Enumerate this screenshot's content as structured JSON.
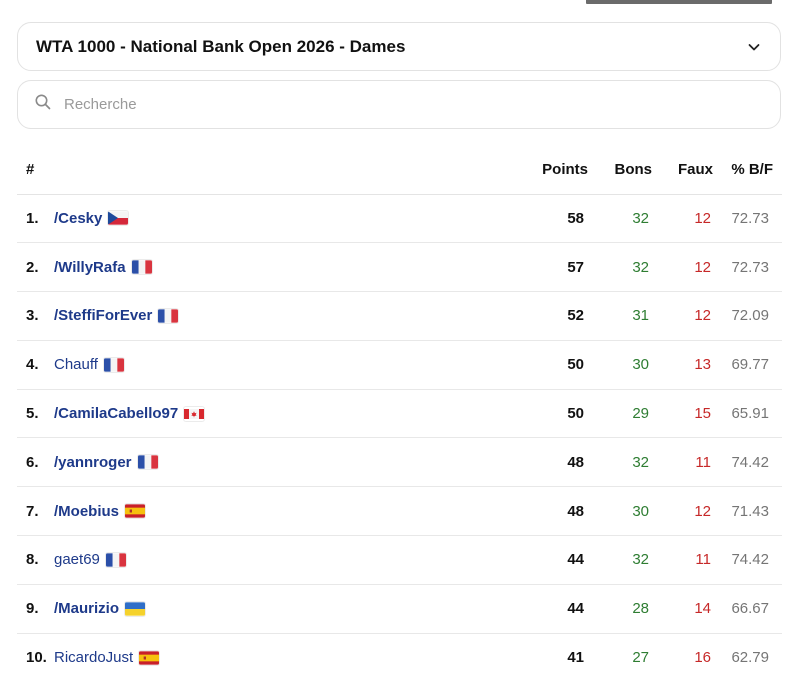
{
  "tournament_select": {
    "label": "WTA 1000 - National Bank Open 2026 - Dames"
  },
  "search": {
    "placeholder": "Recherche",
    "value": ""
  },
  "table": {
    "headers": {
      "rank": "#",
      "points": "Points",
      "bons": "Bons",
      "faux": "Faux",
      "pct": "% B/F"
    },
    "rows": [
      {
        "rank": "1.",
        "name": "/Cesky",
        "bold": true,
        "flag": "cz",
        "points": "58",
        "bons": "32",
        "faux": "12",
        "pct": "72.73"
      },
      {
        "rank": "2.",
        "name": "/WillyRafa",
        "bold": true,
        "flag": "fr",
        "points": "57",
        "bons": "32",
        "faux": "12",
        "pct": "72.73"
      },
      {
        "rank": "3.",
        "name": "/SteffiForEver",
        "bold": true,
        "flag": "fr",
        "points": "52",
        "bons": "31",
        "faux": "12",
        "pct": "72.09"
      },
      {
        "rank": "4.",
        "name": "Chauff",
        "bold": false,
        "flag": "fr",
        "points": "50",
        "bons": "30",
        "faux": "13",
        "pct": "69.77"
      },
      {
        "rank": "5.",
        "name": "/CamilaCabello97",
        "bold": true,
        "flag": "ca",
        "points": "50",
        "bons": "29",
        "faux": "15",
        "pct": "65.91"
      },
      {
        "rank": "6.",
        "name": "/yannroger",
        "bold": true,
        "flag": "fr",
        "points": "48",
        "bons": "32",
        "faux": "11",
        "pct": "74.42"
      },
      {
        "rank": "7.",
        "name": "/Moebius",
        "bold": true,
        "flag": "es",
        "points": "48",
        "bons": "30",
        "faux": "12",
        "pct": "71.43"
      },
      {
        "rank": "8.",
        "name": "gaet69",
        "bold": false,
        "flag": "fr",
        "points": "44",
        "bons": "32",
        "faux": "11",
        "pct": "74.42"
      },
      {
        "rank": "9.",
        "name": "/Maurizio",
        "bold": true,
        "flag": "ua",
        "points": "44",
        "bons": "28",
        "faux": "14",
        "pct": "66.67"
      },
      {
        "rank": "10.",
        "name": "RicardoJust",
        "bold": false,
        "flag": "es",
        "points": "41",
        "bons": "27",
        "faux": "16",
        "pct": "62.79"
      }
    ]
  },
  "colors": {
    "player_link": "#1e3a8a",
    "bons": "#2e7d32",
    "faux": "#c62828",
    "pct": "#757575"
  },
  "icons": {
    "select": "chevron-down-icon",
    "search": "search-icon"
  }
}
